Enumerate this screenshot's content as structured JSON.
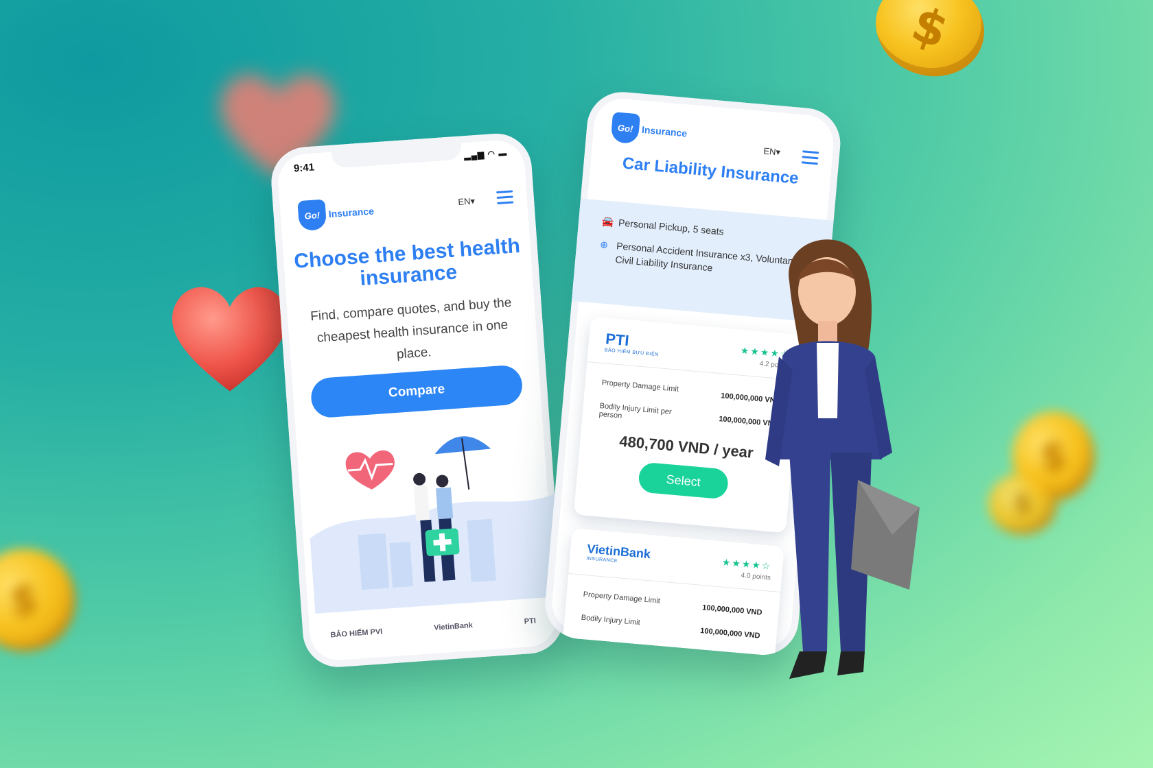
{
  "phone_home": {
    "status_time": "9:41",
    "logo_badge": "Go!",
    "logo_text": "Insurance",
    "lang": "EN▾",
    "hero_title": "Choose the best health insurance",
    "hero_subtitle": "Find, compare quotes, and buy the cheapest health insurance in one place.",
    "compare_label": "Compare",
    "partners": [
      {
        "name": "BẢO HIỂM PVI"
      },
      {
        "name": "VietinBank",
        "sub": "INSURANCE"
      },
      {
        "name": "PTI",
        "sub": "BẢO HIỂM BƯU ĐIỆN"
      }
    ]
  },
  "phone_quotes": {
    "logo_badge": "Go!",
    "logo_text": "Insurance",
    "lang": "EN▾",
    "title": "Car Liability Insurance",
    "vehicle": "Personal Pickup, 5 seats",
    "addons": "Personal Accident Insurance x3, Voluntary Civil Liability Insurance",
    "offers": [
      {
        "brand": "PTI",
        "brand_sub": "BẢO HIỂM BƯU ĐIỆN",
        "stars": "★★★★☆",
        "points": "4.2 points",
        "rows": [
          {
            "label": "Property Damage Limit",
            "value": "100,000,000 VND"
          },
          {
            "label": "Bodily Injury Limit per person",
            "value": "100,000,000 VND"
          }
        ],
        "price": "480,700 VND / year",
        "select_label": "Select"
      },
      {
        "brand": "VietinBank",
        "brand_sub": "INSURANCE",
        "stars": "★★★★☆",
        "points": "4.0 points",
        "rows": [
          {
            "label": "Property Damage Limit",
            "value": "100,000,000 VND"
          },
          {
            "label": "Bodily Injury Limit",
            "value": "100,000,000 VND"
          }
        ]
      }
    ]
  },
  "coin_symbol": "$",
  "colors": {
    "brand_blue": "#2d7ff2",
    "accent_green": "#19d39a"
  }
}
